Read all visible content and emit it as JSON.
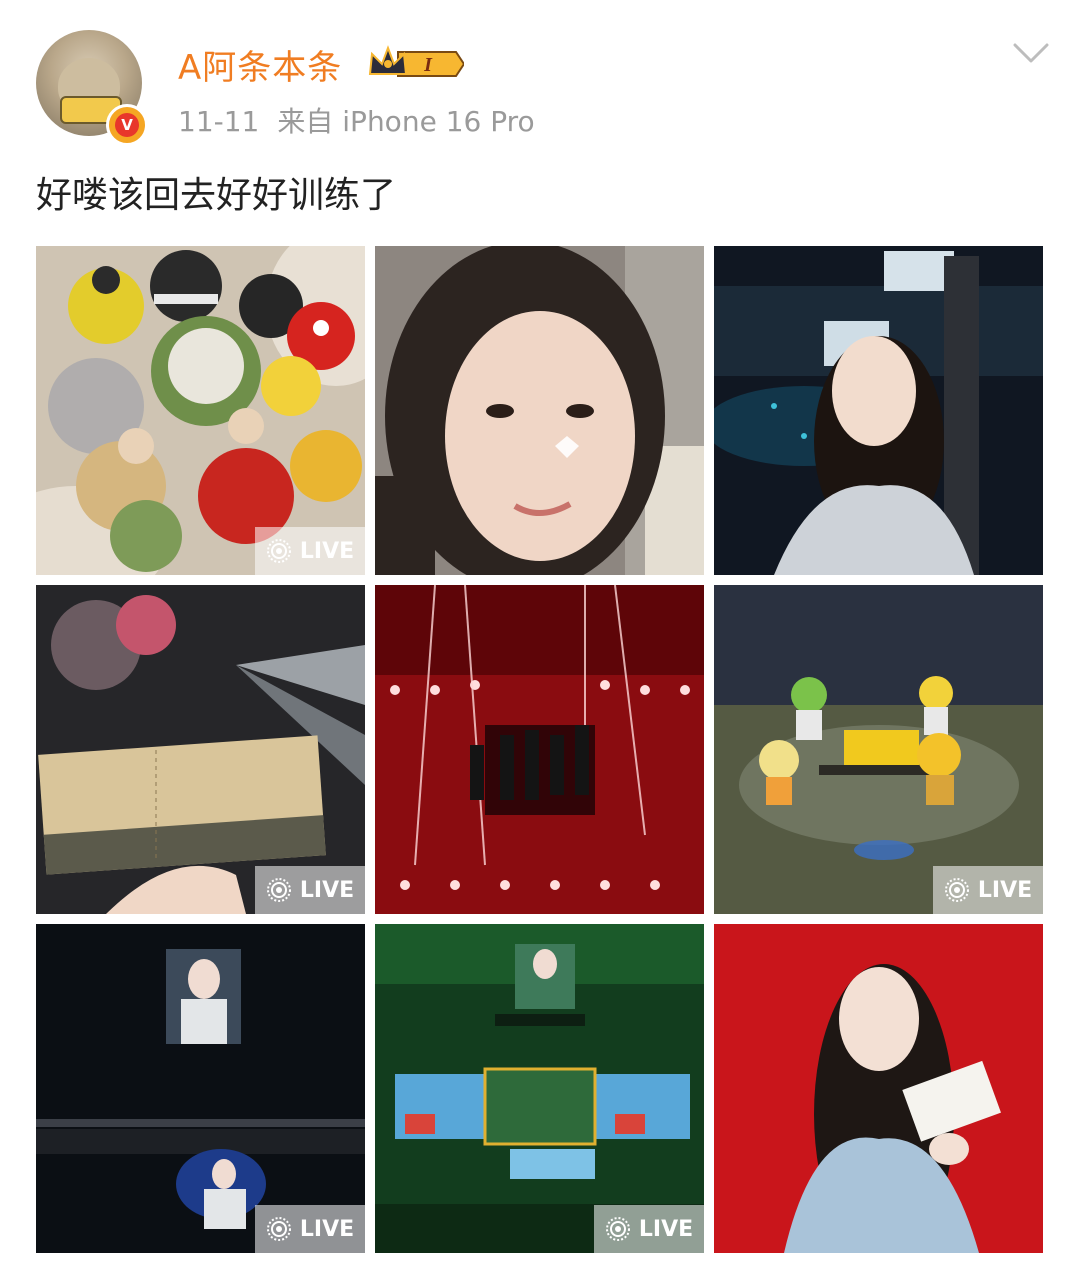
{
  "user": {
    "name": "A阿条本条",
    "vip_level": "I",
    "verify_mark": "V"
  },
  "post": {
    "date": "11-11",
    "source": "来自 iPhone 16 Pro",
    "text": "好喽该回去好好训练了"
  },
  "photos": [
    {
      "desc": "crocheted doll heads",
      "live": true
    },
    {
      "desc": "selfie",
      "live": false
    },
    {
      "desc": "concert selfie",
      "live": false
    },
    {
      "desc": "concert ticket",
      "live": true
    },
    {
      "desc": "red stage",
      "live": false
    },
    {
      "desc": "mascots on stage",
      "live": true
    },
    {
      "desc": "performer on screens",
      "live": true
    },
    {
      "desc": "green stage screens",
      "live": true
    },
    {
      "desc": "portrait with envelope",
      "live": false
    }
  ],
  "live_label": "LIVE",
  "colors": {
    "username": "#f07d22",
    "meta": "#9a9a9a",
    "text": "#222222"
  }
}
